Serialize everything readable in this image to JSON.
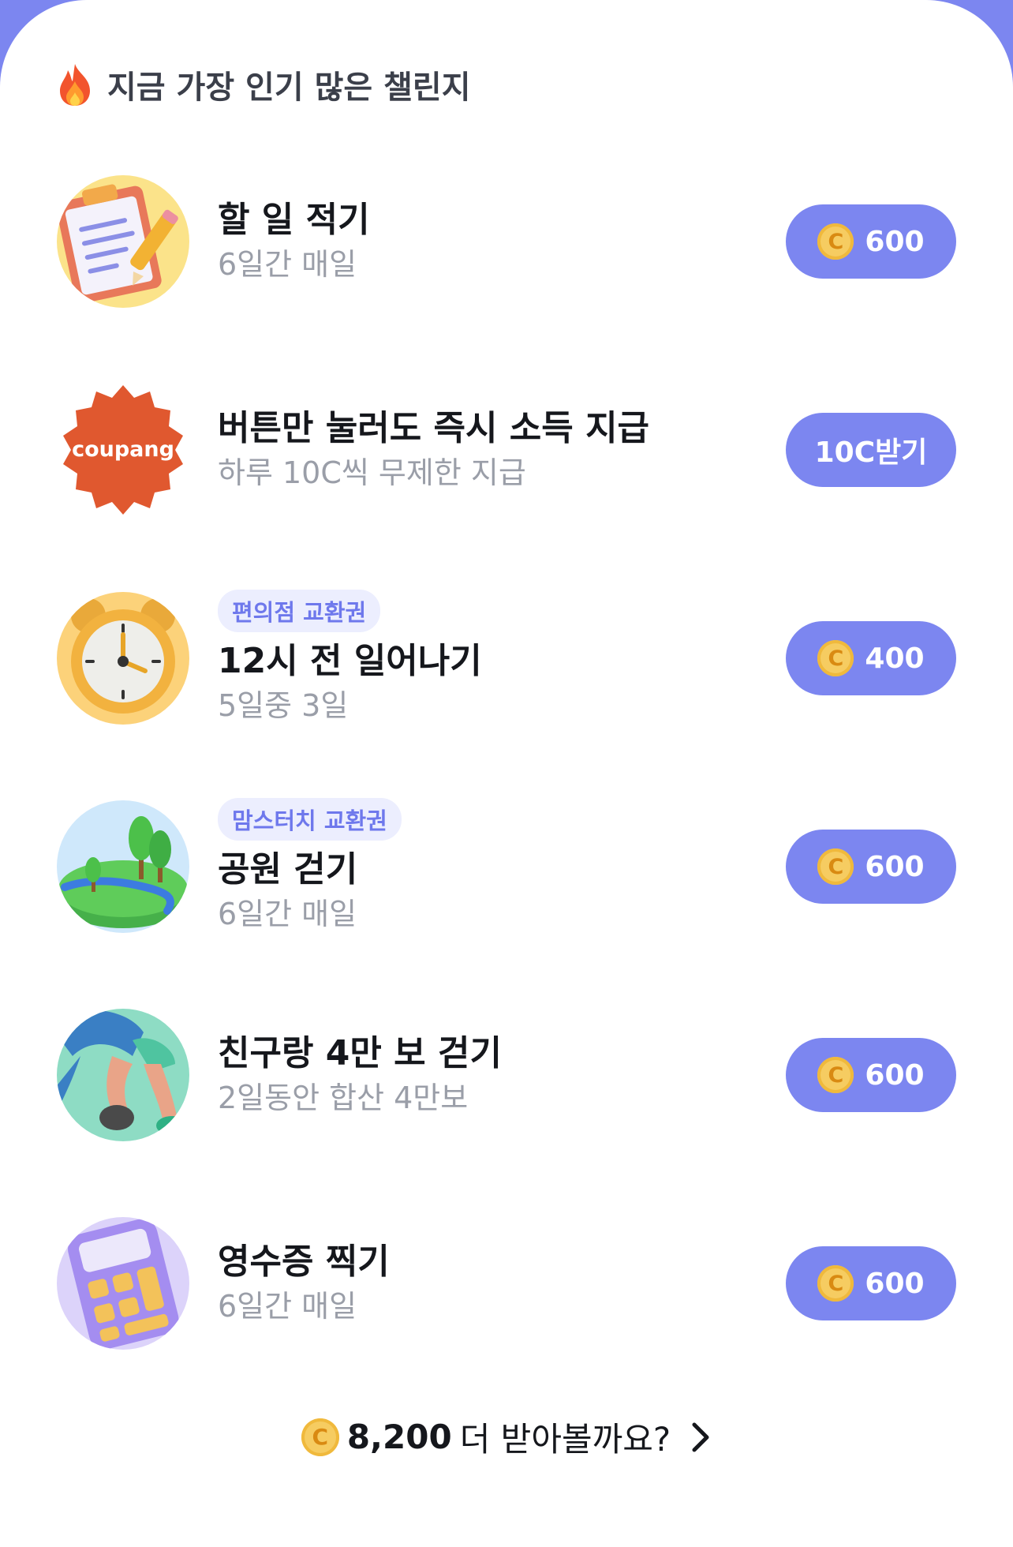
{
  "header": {
    "title": "지금 가장 인기 많은 챌린지",
    "icon": "fire-icon"
  },
  "coin_symbol": "C",
  "challenges": [
    {
      "icon": "clipboard-pencil-icon",
      "title": "할 일 적기",
      "subtitle": "6일간 매일",
      "reward": "600",
      "has_coin": true
    },
    {
      "icon": "coupang-logo",
      "logo_text": "coupang",
      "title": "버튼만 눌러도 즉시 소득 지급",
      "subtitle": "하루 10C씩 무제한 지급",
      "reward": "10C받기",
      "has_coin": false
    },
    {
      "icon": "alarm-clock-icon",
      "tag": "편의점 교환권",
      "title": "12시 전 일어나기",
      "subtitle": "5일중 3일",
      "reward": "400",
      "has_coin": true
    },
    {
      "icon": "park-icon",
      "tag": "맘스터치 교환권",
      "title": "공원 걷기",
      "subtitle": "6일간 매일",
      "reward": "600",
      "has_coin": true
    },
    {
      "icon": "walking-legs-icon",
      "title": "친구랑 4만 보 걷기",
      "subtitle": "2일동안 합산 4만보",
      "reward": "600",
      "has_coin": true
    },
    {
      "icon": "calculator-icon",
      "title": "영수증 찍기",
      "subtitle": "6일간 매일",
      "reward": "600",
      "has_coin": true
    }
  ],
  "footer": {
    "amount": "8,200",
    "text": "더 받아볼까요?"
  },
  "colors": {
    "accent": "#7c86f0",
    "coin": "#f6cc61",
    "tag_bg": "#eceefe",
    "tag_text": "#6e78ec"
  }
}
